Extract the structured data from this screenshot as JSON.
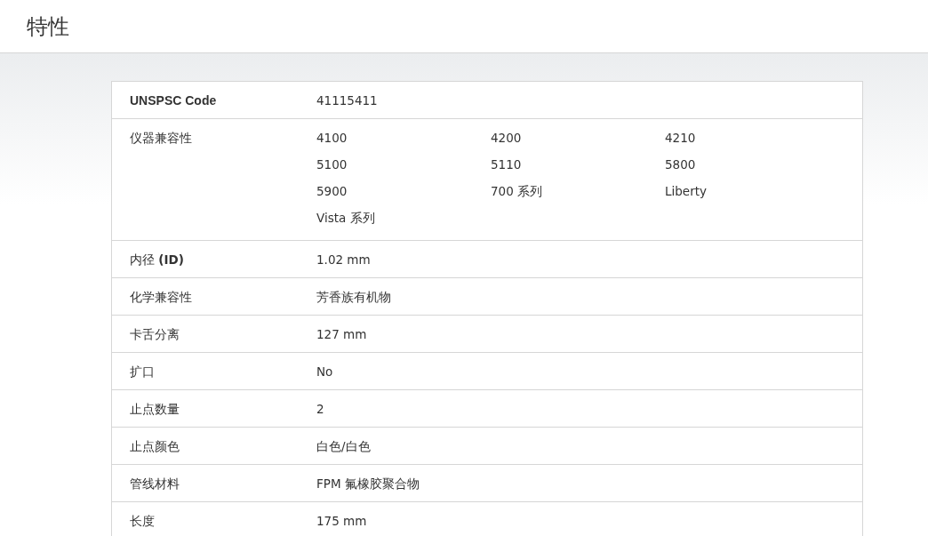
{
  "title": "特性",
  "rows": [
    {
      "label": "UNSPSC Code",
      "label_bold": true,
      "value": "41115411"
    },
    {
      "label": "仪器兼容性",
      "label_bold": false,
      "values": [
        "4100",
        "4200",
        "4210",
        "5100",
        "5110",
        "5800",
        "5900",
        "700 系列",
        "Liberty",
        "Vista 系列"
      ]
    },
    {
      "label": "内径 **(ID)**",
      "label_bold": false,
      "value": "1.02 mm"
    },
    {
      "label": "化学兼容性",
      "label_bold": false,
      "value": "芳香族有机物"
    },
    {
      "label": "卡舌分离",
      "label_bold": false,
      "value": "127 mm"
    },
    {
      "label": "扩口",
      "label_bold": false,
      "value": "No"
    },
    {
      "label": "止点数量",
      "label_bold": false,
      "value": "2"
    },
    {
      "label": "止点颜色",
      "label_bold": false,
      "value": "白色/白色"
    },
    {
      "label": "管线材料",
      "label_bold": false,
      "value": "FPM 氟橡胶聚合物"
    },
    {
      "label": "长度",
      "label_bold": false,
      "value": "175 mm"
    }
  ]
}
